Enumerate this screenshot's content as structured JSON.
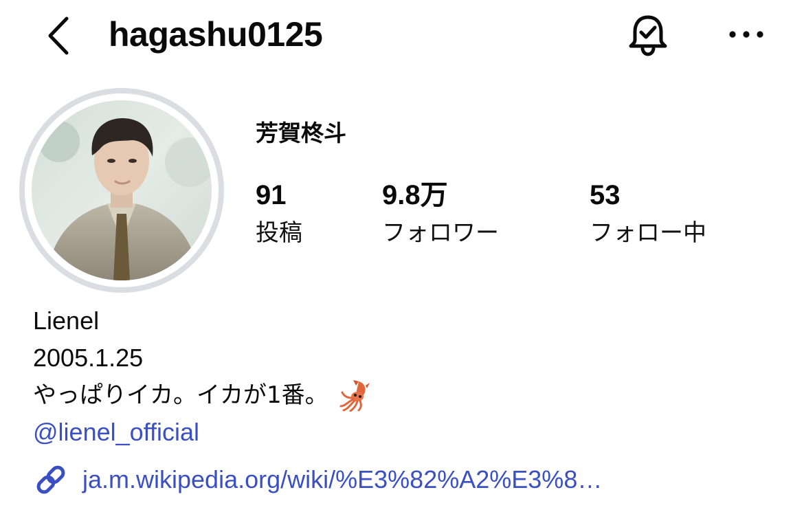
{
  "header": {
    "username": "hagashu0125",
    "icons": {
      "back": "chevron-left-icon",
      "notifications": "bell-check-icon",
      "more": "ellipsis-icon"
    }
  },
  "profile": {
    "display_name": "芳賀柊斗",
    "avatar": "profile-photo",
    "stats": [
      {
        "value": "91",
        "label": "投稿"
      },
      {
        "value": "9.8万",
        "label": "フォロワー"
      },
      {
        "value": "53",
        "label": "フォロー中"
      }
    ]
  },
  "bio": {
    "line1": "Lienel",
    "line2": "2005.1.25",
    "line3": "やっぱりイカ。イカが1番。",
    "line3_emoji": "squid-icon",
    "mention": "@lienel_official",
    "link": "ja.m.wikipedia.org/wiki/%E3%82%A2%E3%8…",
    "link_icon": "link-icon"
  },
  "colors": {
    "text": "#0a0a0a",
    "link": "#3a4fc2",
    "avatar_ring": "#dcdde3"
  }
}
